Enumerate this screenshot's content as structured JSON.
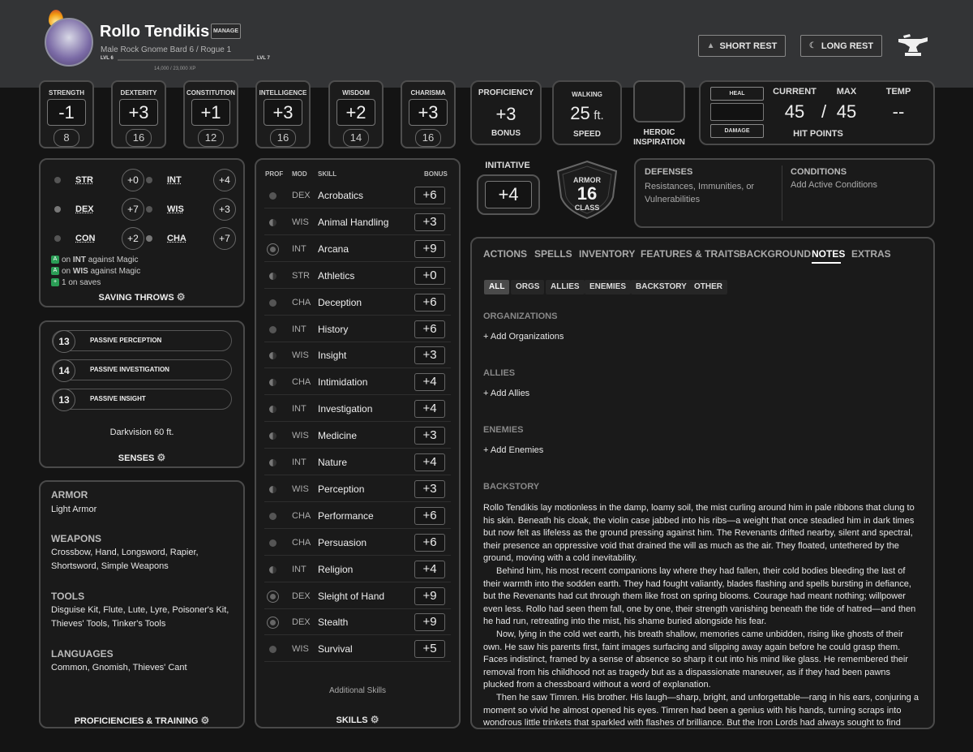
{
  "header": {
    "name": "Rollo Tendikis",
    "manage": "MANAGE",
    "subtitle": "Male  Rock Gnome  Bard 6 / Rogue 1",
    "level_left": "LVL 6",
    "level_right": "LVL 7",
    "xp": "14,000 / 23,000 XP",
    "short_rest": "SHORT REST",
    "long_rest": "LONG REST"
  },
  "abilities": [
    {
      "label": "STRENGTH",
      "mod": "-1",
      "score": "8"
    },
    {
      "label": "DEXTERITY",
      "mod": "+3",
      "score": "16"
    },
    {
      "label": "CONSTITUTION",
      "mod": "+1",
      "score": "12"
    },
    {
      "label": "INTELLIGENCE",
      "mod": "+3",
      "score": "16"
    },
    {
      "label": "WISDOM",
      "mod": "+2",
      "score": "14"
    },
    {
      "label": "CHARISMA",
      "mod": "+3",
      "score": "16"
    }
  ],
  "proficiency": {
    "label": "PROFICIENCY",
    "value": "+3",
    "sub": "BONUS"
  },
  "speed": {
    "label": "WALKING",
    "value": "25",
    "unit": "ft.",
    "sub": "SPEED"
  },
  "inspiration": {
    "label1": "HEROIC",
    "label2": "INSPIRATION"
  },
  "hp": {
    "heal": "HEAL",
    "damage": "DAMAGE",
    "current_label": "CURRENT",
    "max_label": "MAX",
    "temp_label": "TEMP",
    "current": "45",
    "sep": "/",
    "max": "45",
    "temp": "--",
    "title": "HIT POINTS"
  },
  "saves": {
    "rows": [
      {
        "name": "STR",
        "val": "+0"
      },
      {
        "name": "INT",
        "val": "+4"
      },
      {
        "name": "DEX",
        "val": "+7"
      },
      {
        "name": "WIS",
        "val": "+3"
      },
      {
        "name": "CON",
        "val": "+2"
      },
      {
        "name": "CHA",
        "val": "+7"
      }
    ],
    "note1_a": "on ",
    "note1_b": "INT",
    "note1_c": " against Magic",
    "note2_a": "on ",
    "note2_b": "WIS",
    "note2_c": " against Magic",
    "note3": "1 on saves",
    "title": "SAVING THROWS"
  },
  "senses": {
    "items": [
      {
        "n": "13",
        "t": "PASSIVE PERCEPTION"
      },
      {
        "n": "14",
        "t": "PASSIVE INVESTIGATION"
      },
      {
        "n": "13",
        "t": "PASSIVE INSIGHT"
      }
    ],
    "darkvision": "Darkvision 60 ft.",
    "title": "SENSES"
  },
  "proficiencies": {
    "armor_h": "ARMOR",
    "armor": "Light Armor",
    "weapons_h": "WEAPONS",
    "weapons": "Crossbow, Hand, Longsword, Rapier, Shortsword, Simple Weapons",
    "tools_h": "TOOLS",
    "tools": "Disguise Kit, Flute, Lute, Lyre, Poisoner's Kit, Thieves' Tools, Tinker's Tools",
    "languages_h": "LANGUAGES",
    "languages": "Common, Gnomish, Thieves' Cant",
    "title": "PROFICIENCIES & TRAINING"
  },
  "skills": {
    "h_prof": "PROF",
    "h_mod": "MOD",
    "h_skill": "SKILL",
    "h_bonus": "BONUS",
    "rows": [
      {
        "mod": "DEX",
        "name": "Acrobatics",
        "bonus": "+6",
        "prof": "full"
      },
      {
        "mod": "WIS",
        "name": "Animal Handling",
        "bonus": "+3",
        "prof": "half"
      },
      {
        "mod": "INT",
        "name": "Arcana",
        "bonus": "+9",
        "prof": "exp"
      },
      {
        "mod": "STR",
        "name": "Athletics",
        "bonus": "+0",
        "prof": "half"
      },
      {
        "mod": "CHA",
        "name": "Deception",
        "bonus": "+6",
        "prof": "full"
      },
      {
        "mod": "INT",
        "name": "History",
        "bonus": "+6",
        "prof": "full"
      },
      {
        "mod": "WIS",
        "name": "Insight",
        "bonus": "+3",
        "prof": "half"
      },
      {
        "mod": "CHA",
        "name": "Intimidation",
        "bonus": "+4",
        "prof": "half"
      },
      {
        "mod": "INT",
        "name": "Investigation",
        "bonus": "+4",
        "prof": "half"
      },
      {
        "mod": "WIS",
        "name": "Medicine",
        "bonus": "+3",
        "prof": "half"
      },
      {
        "mod": "INT",
        "name": "Nature",
        "bonus": "+4",
        "prof": "half"
      },
      {
        "mod": "WIS",
        "name": "Perception",
        "bonus": "+3",
        "prof": "half"
      },
      {
        "mod": "CHA",
        "name": "Performance",
        "bonus": "+6",
        "prof": "full"
      },
      {
        "mod": "CHA",
        "name": "Persuasion",
        "bonus": "+6",
        "prof": "full"
      },
      {
        "mod": "INT",
        "name": "Religion",
        "bonus": "+4",
        "prof": "half"
      },
      {
        "mod": "DEX",
        "name": "Sleight of Hand",
        "bonus": "+9",
        "prof": "exp"
      },
      {
        "mod": "DEX",
        "name": "Stealth",
        "bonus": "+9",
        "prof": "exp"
      },
      {
        "mod": "WIS",
        "name": "Survival",
        "bonus": "+5",
        "prof": "full"
      }
    ],
    "additional": "Additional Skills",
    "title": "SKILLS"
  },
  "initiative": {
    "label": "INITIATIVE",
    "value": "+4"
  },
  "armor": {
    "top": "ARMOR",
    "value": "16",
    "bottom": "CLASS"
  },
  "defenses": {
    "title": "DEFENSES",
    "text": "Resistances, Immunities, or Vulnerabilities",
    "cond_title": "CONDITIONS",
    "cond_text": "Add Active Conditions"
  },
  "tabs": [
    "ACTIONS",
    "SPELLS",
    "INVENTORY",
    "FEATURES & TRAITS",
    "BACKGROUND",
    "NOTES",
    "EXTRAS"
  ],
  "filters": [
    "ALL",
    "ORGS",
    "ALLIES",
    "ENEMIES",
    "BACKSTORY",
    "OTHER"
  ],
  "notes": {
    "org_h": "ORGANIZATIONS",
    "org_add": "+ Add Organizations",
    "allies_h": "ALLIES",
    "allies_add": "+ Add Allies",
    "enemies_h": "ENEMIES",
    "enemies_add": "+ Add Enemies",
    "backstory_h": "BACKSTORY",
    "p1": "Rollo Tendikis lay motionless in the damp, loamy soil, the mist curling around him in pale ribbons that clung to his skin. Beneath his cloak, the violin case jabbed into his ribs—a weight that once steadied him in dark times but now felt as lifeless as the ground pressing against him. The Revenants drifted nearby, silent and spectral, their presence an oppressive void that drained the will as much as the air. They floated, untethered by the ground, moving with a cold inevitability.",
    "p2": "Behind him, his most recent companions lay where they had fallen, their cold bodies bleeding the last of their warmth into the sodden earth. They had fought valiantly, blades flashing and spells bursting in defiance, but the Revenants had cut through them like frost on spring blooms. Courage had meant nothing; willpower even less. Rollo had seen them fall, one by one, their strength vanishing beneath the tide of hatred—and then he had run, retreating into the mist, his shame buried alongside his fear.",
    "p3": "Now, lying in the cold wet earth, his breath shallow, memories came unbidden, rising like ghosts of their own. He saw his parents first, faint images surfacing and slipping away again before he could grasp them. Faces indistinct, framed by a sense of absence so sharp it cut into his mind like glass. He remembered their removal from his childhood not as tragedy but as a dispassionate maneuver, as if they had been pawns plucked from a chessboard without a word of explanation.",
    "p4": "Then he saw Timren. His brother. His laugh—sharp, bright, and unforgettable—rang in his ears, conjuring a moment so vivid he almost opened his eyes. Timren had been a genius with his hands, turning scraps into wondrous little trinkets that sparkled with flashes of brilliance. But the Iron Lords had always sought to find"
  },
  "colors": {
    "accent": "#2a9d55",
    "panel": "#1a1a1a",
    "border": "#4a4a4a",
    "header": "#333436"
  }
}
